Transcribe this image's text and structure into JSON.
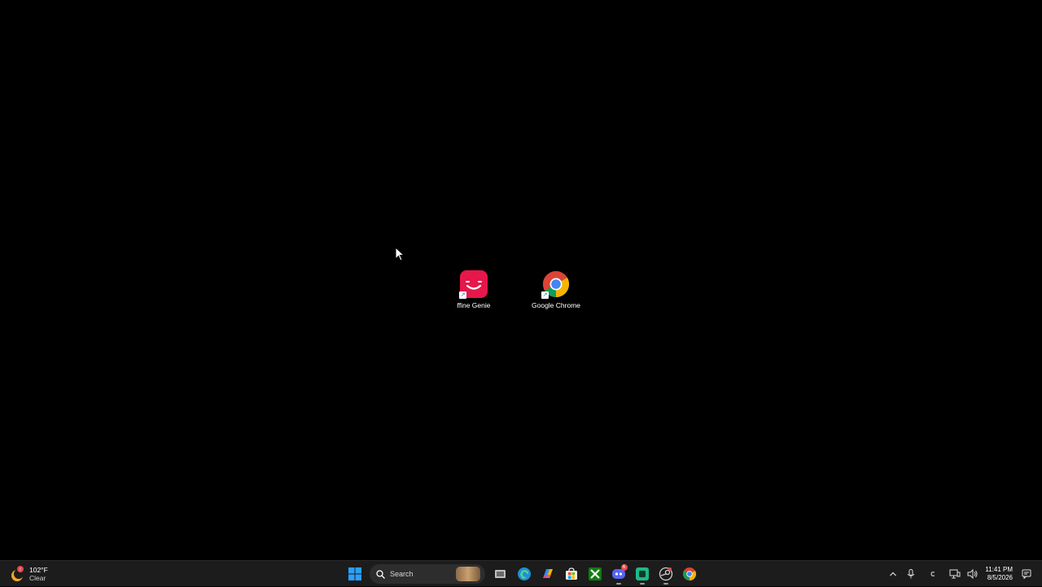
{
  "desktop": {
    "icons": [
      {
        "label": "ffine Genie",
        "icon": "fifine-genie-icon"
      },
      {
        "label": "Google Chrome",
        "icon": "google-chrome-icon"
      }
    ]
  },
  "taskbar": {
    "weather": {
      "temp": "102°F",
      "condition": "Clear",
      "icon": "weather-sun-icon"
    },
    "search": {
      "placeholder": "Search"
    },
    "apps": [
      {
        "icon": "windows-start-icon"
      },
      {
        "icon": "search-icon"
      },
      {
        "icon": "task-view-icon"
      },
      {
        "icon": "edge-icon"
      },
      {
        "icon": "copilot-icon"
      },
      {
        "icon": "microsoft-store-icon"
      },
      {
        "icon": "xbox-icon"
      },
      {
        "icon": "discord-icon",
        "badge": "6"
      },
      {
        "icon": "app-green-icon"
      },
      {
        "icon": "steam-icon"
      },
      {
        "icon": "chrome-icon"
      }
    ],
    "clock": {
      "time": "11:41 PM",
      "date": "8/5/2026"
    },
    "tray": [
      "chevron-up-icon",
      "microphone-icon",
      "language-icon",
      "network-icon",
      "volume-icon",
      "notification-icon"
    ],
    "colors": {
      "accent": "#0a84ff",
      "taskbar": "#1c1c1c"
    }
  }
}
